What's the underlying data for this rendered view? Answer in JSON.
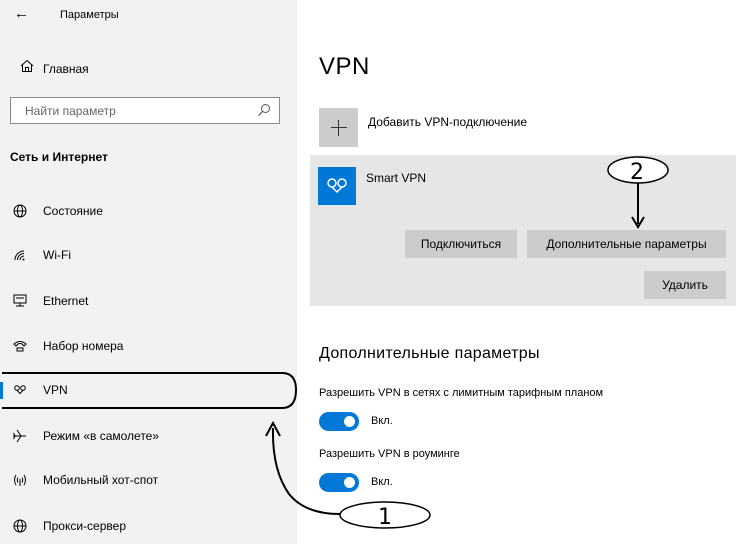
{
  "app_title": "Параметры",
  "sidebar": {
    "home_label": "Главная",
    "search_placeholder": "Найти параметр",
    "section_heading": "Сеть и Интернет",
    "items": [
      {
        "label": "Состояние",
        "icon": "globe-icon",
        "active": false
      },
      {
        "label": "Wi-Fi",
        "icon": "wifi-icon",
        "active": false
      },
      {
        "label": "Ethernet",
        "icon": "ethernet-icon",
        "active": false
      },
      {
        "label": "Набор номера",
        "icon": "dialup-icon",
        "active": false
      },
      {
        "label": "VPN",
        "icon": "vpn-icon",
        "active": true
      },
      {
        "label": "Режим «в самолете»",
        "icon": "airplane-icon",
        "active": false
      },
      {
        "label": "Мобильный хот-спот",
        "icon": "hotspot-icon",
        "active": false
      },
      {
        "label": "Прокси-сервер",
        "icon": "proxy-globe-icon",
        "active": false
      }
    ]
  },
  "main": {
    "title": "VPN",
    "add_vpn_label": "Добавить VPN-подключение",
    "connection": {
      "name": "Smart VPN",
      "connect_button": "Подключиться",
      "advanced_button": "Дополнительные параметры",
      "delete_button": "Удалить"
    },
    "advanced_heading": "Дополнительные параметры",
    "settings": [
      {
        "label": "Разрешить VPN в сетях с лимитным тарифным планом",
        "state": "Вкл.",
        "on": true
      },
      {
        "label": "Разрешить VPN в роуминге",
        "state": "Вкл.",
        "on": true
      }
    ]
  },
  "annotations": {
    "marker_1": "1",
    "marker_2": "2"
  },
  "colors": {
    "accent": "#0078d7",
    "sidebar_bg": "#f2f2f2",
    "card_bg": "#e6e6e6",
    "button_bg": "#cccccc"
  }
}
